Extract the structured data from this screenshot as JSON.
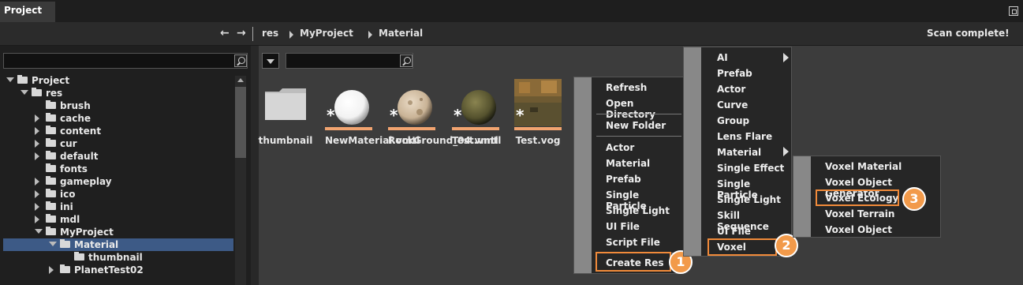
{
  "panel": {
    "tab_title": "Project"
  },
  "nav": {
    "back": "←",
    "forward": "→",
    "crumbs": [
      "res",
      "MyProject",
      "Material"
    ],
    "status": "Scan complete!"
  },
  "tree": [
    {
      "label": "Project",
      "depth": 0,
      "expander": "open"
    },
    {
      "label": "res",
      "depth": 1,
      "expander": "open"
    },
    {
      "label": "brush",
      "depth": 2,
      "expander": "none"
    },
    {
      "label": "cache",
      "depth": 2,
      "expander": "closed"
    },
    {
      "label": "content",
      "depth": 2,
      "expander": "closed"
    },
    {
      "label": "cur",
      "depth": 2,
      "expander": "closed"
    },
    {
      "label": "default",
      "depth": 2,
      "expander": "closed"
    },
    {
      "label": "fonts",
      "depth": 2,
      "expander": "none"
    },
    {
      "label": "gameplay",
      "depth": 2,
      "expander": "closed"
    },
    {
      "label": "ico",
      "depth": 2,
      "expander": "closed"
    },
    {
      "label": "ini",
      "depth": 2,
      "expander": "closed"
    },
    {
      "label": "mdl",
      "depth": 2,
      "expander": "closed"
    },
    {
      "label": "MyProject",
      "depth": 2,
      "expander": "open"
    },
    {
      "label": "Material",
      "depth": 3,
      "expander": "open",
      "selected": true
    },
    {
      "label": "thumbnail",
      "depth": 4,
      "expander": "none"
    },
    {
      "label": "PlanetTest02",
      "depth": 3,
      "expander": "closed"
    }
  ],
  "assets": [
    {
      "label": "thumbnail",
      "kind": "folder"
    },
    {
      "label": "NewMaterial.vmtl",
      "kind": "white-sphere",
      "star": "*"
    },
    {
      "label": "RockGround_04.vmtl",
      "kind": "rock-sphere",
      "star": "*"
    },
    {
      "label": "Test.vmtl",
      "kind": "moss-sphere",
      "star": "*"
    },
    {
      "label": "Test.vog",
      "kind": "terrain",
      "star": "*"
    }
  ],
  "context_menu": {
    "groups": [
      [
        "Refresh",
        "Open Directory"
      ],
      [
        "New Folder"
      ],
      [
        "Actor",
        "Material",
        "Prefab",
        "Single Particle",
        "Single Light",
        "UI File",
        "Script File"
      ],
      [
        "Create Res"
      ]
    ]
  },
  "create_res_menu": {
    "items": [
      "AI",
      "Prefab",
      "Actor",
      "Curve",
      "Group",
      "Lens Flare",
      "Material",
      "Single Effect",
      "Single Particle",
      "Single Light",
      "Skill Sequence",
      "UI File",
      "Voxel"
    ]
  },
  "voxel_menu": {
    "items": [
      "Voxel Material",
      "Voxel Object Generator",
      "Voxel Ecology",
      "Voxel Terrain",
      "Voxel Object"
    ]
  },
  "badges": [
    "1",
    "2",
    "3"
  ]
}
